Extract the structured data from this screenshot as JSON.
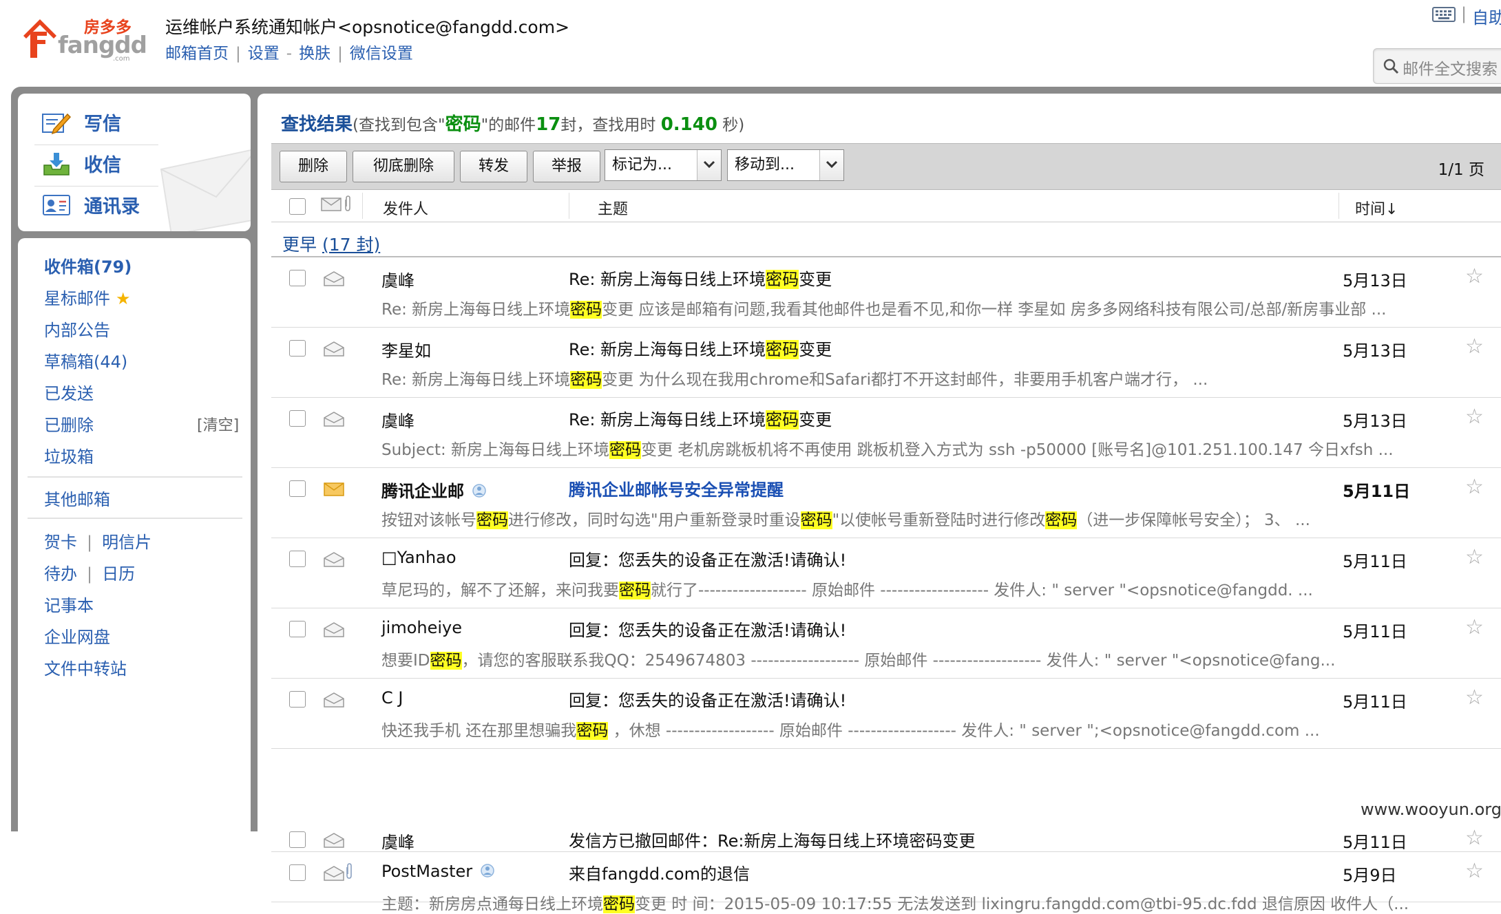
{
  "header": {
    "logo_cn": "房多多",
    "logo_en": "fangdd",
    "logo_domain": ".com",
    "account_title": "运维帐户系统通知帐户<opsnotice@fangdd.com>",
    "links": [
      "邮箱首页",
      "设置",
      "换肤",
      "微信设置"
    ],
    "self_help": "自助",
    "search_placeholder": "邮件全文搜索"
  },
  "left_nav": {
    "main": [
      {
        "label": "写信",
        "icon": "compose-icon"
      },
      {
        "label": "收信",
        "icon": "inbox-download-icon"
      },
      {
        "label": "通讯录",
        "icon": "contacts-icon"
      }
    ],
    "folders": [
      {
        "label": "收件箱(79)",
        "bold": true
      },
      {
        "label": "星标邮件"
      },
      {
        "label": "内部公告"
      },
      {
        "label": "草稿箱(44)"
      },
      {
        "label": "已发送"
      },
      {
        "label": "已删除",
        "extra": "[清空]"
      },
      {
        "label": "垃圾箱"
      }
    ],
    "other_box": "其他邮箱",
    "apps": {
      "greeting_card": "贺卡",
      "postcard": "明信片",
      "todo": "待办",
      "calendar": "日历",
      "notes": "记事本",
      "netdisk": "企业网盘",
      "file_transfer": "文件中转站"
    }
  },
  "results": {
    "title": "查找结果",
    "desc_prefix": "(查找到包含\"",
    "keyword": "密码",
    "desc_mid": "\"的邮件",
    "count": "17",
    "desc_mid2": "封，查找用时 ",
    "time": "0.140",
    "desc_suffix": " 秒)"
  },
  "toolbar": {
    "delete": "删除",
    "delete_forever": "彻底删除",
    "forward": "转发",
    "report": "举报",
    "mark_as": "标记为...",
    "move_to": "移动到...",
    "pager": "1/1 页"
  },
  "columns": {
    "from": "发件人",
    "subject": "主题",
    "time": "时间↓"
  },
  "group": {
    "label": "更早",
    "count": "(17 封)"
  },
  "emails": [
    {
      "from": "虞峰",
      "verified": false,
      "unread": false,
      "icon": "envelope-read-icon",
      "attachment": false,
      "subject": [
        "Re: 新房上海每日线上环境",
        "密码",
        "变更"
      ],
      "date": "5月13日",
      "preview": [
        "Re: 新房上海每日线上环境",
        "密码",
        "变更 应该是邮箱有问题,我看其他邮件也是看不见,和你一样 李星如 房多多网络科技有限公司/总部/新房事业部 ..."
      ]
    },
    {
      "from": "李星如",
      "verified": false,
      "unread": false,
      "icon": "envelope-read-icon",
      "attachment": false,
      "subject": [
        "Re: 新房上海每日线上环境",
        "密码",
        "变更"
      ],
      "date": "5月13日",
      "preview": [
        "Re: 新房上海每日线上环境",
        "密码",
        "变更 为什么现在我用chrome和Safari都打不开这封邮件，非要用手机客户端才行，  ..."
      ]
    },
    {
      "from": "虞峰",
      "verified": false,
      "unread": false,
      "icon": "envelope-read-icon",
      "attachment": false,
      "subject": [
        "Re: 新房上海每日线上环境",
        "密码",
        "变更"
      ],
      "date": "5月13日",
      "preview": [
        "Subject: 新房上海每日线上环境",
        "密码",
        "变更 老机房跳板机将不再使用 跳板机登入方式为 ssh -p50000 [账号名]@101.251.100.147 今日xfsh ..."
      ]
    },
    {
      "from": "腾讯企业邮",
      "verified": true,
      "unread": true,
      "icon": "envelope-unread-icon",
      "attachment": false,
      "subject": [
        "腾讯企业邮帐号安全异常提醒",
        "",
        ""
      ],
      "date": "5月11日",
      "preview": [
        "按钮对该帐号",
        "密码",
        "进行修改，同时勾选\"用户重新登录时重设",
        "密码",
        "\"以使帐号重新登陆时进行修改",
        "密码",
        "（进一步保障帐号安全）；  3、  ..."
      ]
    },
    {
      "from": "□Yanhao",
      "verified": false,
      "unread": false,
      "icon": "envelope-read-icon",
      "attachment": false,
      "subject": [
        "回复：您丢失的设备正在激活!请确认!",
        "",
        ""
      ],
      "date": "5月11日",
      "preview": [
        "草尼玛的，解不了还解，来问我要",
        "密码",
        "就行了------------------- 原始邮件 ------------------- 发件人: \" server \"<opsnotice@fangdd. ..."
      ]
    },
    {
      "from": "jimoheiye",
      "verified": false,
      "unread": false,
      "icon": "envelope-read-icon",
      "attachment": false,
      "subject": [
        "回复：您丢失的设备正在激活!请确认!",
        "",
        ""
      ],
      "date": "5月11日",
      "preview": [
        "想要ID",
        "密码",
        "，请您的客服联系我QQ：2549674803 ------------------- 原始邮件 ------------------- 发件人: \" server \"<opsnotice@fang..."
      ]
    },
    {
      "from": "C J",
      "verified": false,
      "unread": false,
      "icon": "envelope-read-icon",
      "attachment": false,
      "subject": [
        "回复：您丢失的设备正在激活!请确认!",
        "",
        ""
      ],
      "date": "5月11日",
      "preview": [
        "快还我手机 还在那里想骗我",
        "密码",
        " ，休想 ------------------- 原始邮件 ------------------- 发件人: \" server \";<opsnotice@fangdd.com ..."
      ]
    },
    {
      "from": "虞峰",
      "verified": false,
      "unread": false,
      "icon": "envelope-read-icon",
      "attachment": false,
      "subject": [
        "发信方已撤回邮件：Re:新房上海每日线上环境密码变更",
        "",
        ""
      ],
      "date": "5月11日",
      "preview": [
        "",
        "",
        ""
      ]
    },
    {
      "from": "PostMaster",
      "verified": true,
      "unread": false,
      "icon": "envelope-read-icon",
      "attachment": true,
      "subject": [
        "来自fangdd.com的退信",
        "",
        ""
      ],
      "date": "5月9日",
      "preview": [
        "主题：新房房点通每日线上环境",
        "密码",
        "变更 时 间：2015-05-09 10:17:55 无法发送到 lixingru.fangdd.com@tbi-95.dc.fdd 退信原因 收件人（..."
      ]
    }
  ],
  "watermark": "www.wooyun.org",
  "colors": {
    "link": "#2a5fb0",
    "highlight": "#ffff22",
    "count_green": "#0a8f10",
    "frame_gray": "#8a8a8a"
  }
}
